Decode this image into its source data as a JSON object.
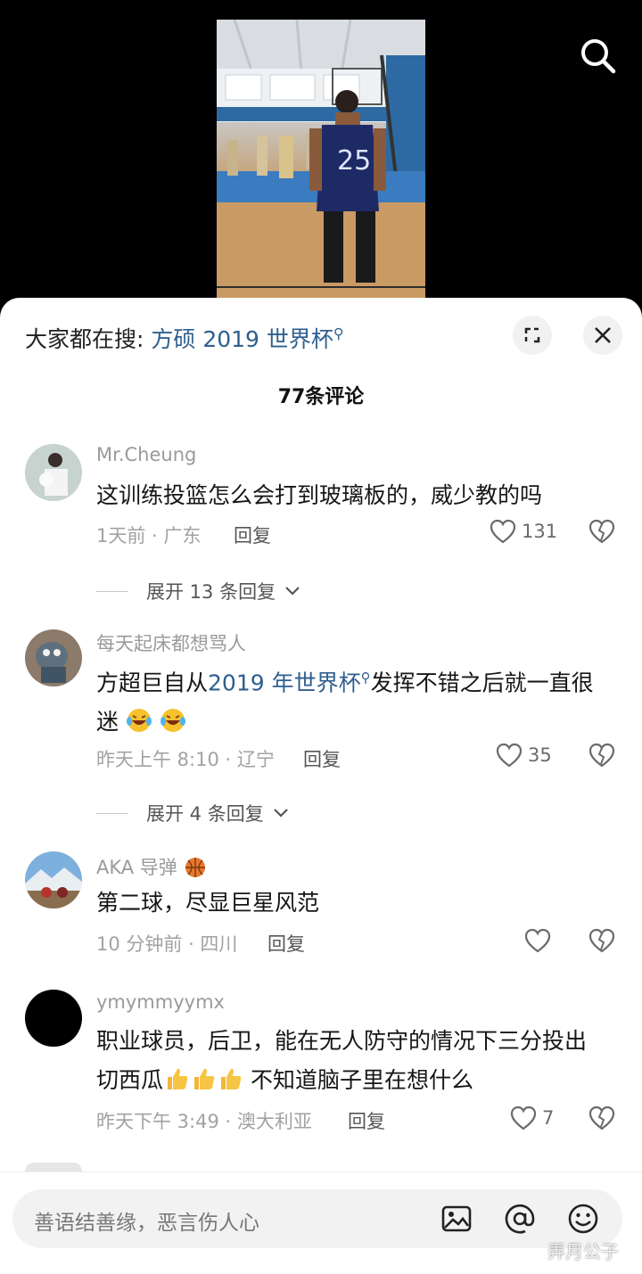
{
  "hot_search": {
    "prefix": "大家都在搜: ",
    "term": "方硕 2019 世界杯"
  },
  "comments_count_title": "77条评论",
  "comments": [
    {
      "user": "Mr.Cheung",
      "text": "这训练投篮怎么会打到玻璃板的，威少教的吗",
      "meta": "1天前 · 广东",
      "reply_label": "回复",
      "likes": "131",
      "expand_label": "展开 13 条回复"
    },
    {
      "user": "每天起床都想骂人",
      "text_part1": "方超巨自从",
      "link": "2019 年世界杯",
      "text_part2": "发挥不错之后就一直很迷",
      "meta": "昨天上午 8:10 · 辽宁",
      "reply_label": "回复",
      "likes": "35",
      "expand_label": "展开 4 条回复"
    },
    {
      "user": "AKA 导弹",
      "text": "第二球，尽显巨星风范",
      "meta": "10 分钟前 · 四川",
      "reply_label": "回复",
      "likes": ""
    },
    {
      "user": "ymymmyymx",
      "text_line1": "职业球员，后卫，能在无人防守的情况下三分投出",
      "text_line2_a": "切西瓜",
      "text_line2_b": " 不知道脑子里在想什么",
      "meta": "昨天下午 3:49 · 澳大利亚",
      "reply_label": "回复",
      "likes": "7"
    }
  ],
  "input": {
    "placeholder": "善语结善缘，恶言伤人心"
  },
  "video": {
    "jersey_number": "25"
  },
  "watermark": "弄月公子",
  "colors": {
    "link": "#2f5f8f",
    "meta": "#a2a2a2",
    "background_top": "#000000"
  }
}
